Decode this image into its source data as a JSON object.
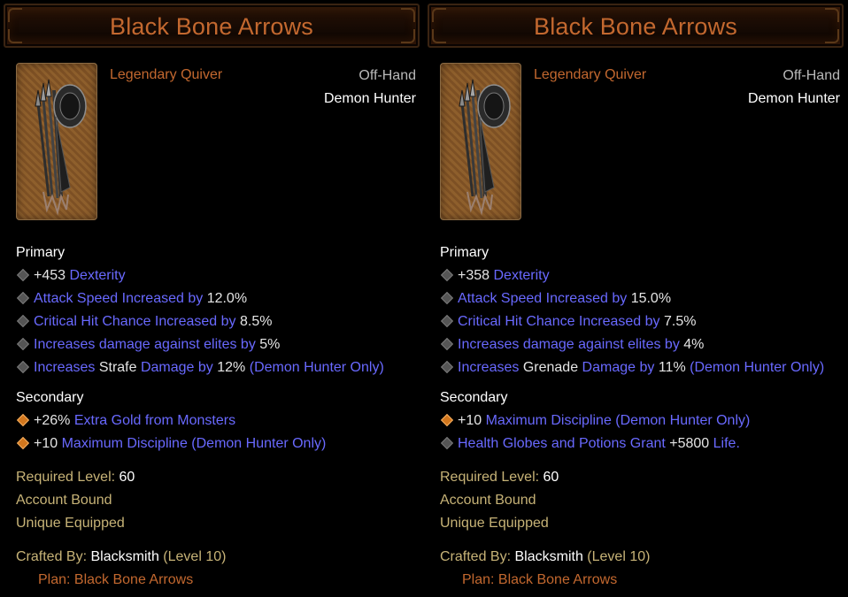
{
  "items": [
    {
      "title": "Black Bone Arrows",
      "item_type": "Legendary Quiver",
      "slot": "Off-Hand",
      "class": "Demon Hunter",
      "primary_heading": "Primary",
      "primary": [
        {
          "pre": "+453",
          "mid": "Dexterity",
          "post": "",
          "tail": ""
        },
        {
          "pre": "",
          "mid": "Attack Speed Increased by",
          "post": "12.0%",
          "tail": ""
        },
        {
          "pre": "",
          "mid": "Critical Hit Chance Increased by",
          "post": "8.5%",
          "tail": ""
        },
        {
          "pre": "",
          "mid": "Increases damage against elites by",
          "post": "5%",
          "tail": ""
        },
        {
          "pre": "",
          "mid": "Increases",
          "post": "Strafe",
          "tail": "Damage by",
          "val": "12%",
          "extra": "(Demon Hunter Only)"
        }
      ],
      "secondary_heading": "Secondary",
      "secondary": [
        {
          "pre": "+26%",
          "mid": "Extra Gold from Monsters"
        },
        {
          "pre": "+10",
          "mid": "Maximum Discipline (Demon Hunter Only)"
        }
      ],
      "required_level_label": "Required Level:",
      "required_level_value": "60",
      "account_bound": "Account Bound",
      "unique_equipped": "Unique Equipped",
      "crafted_by_label": "Crafted By:",
      "crafted_by_name": "Blacksmith",
      "crafted_by_level": "(Level 10)",
      "plan": "Plan: Black Bone Arrows"
    },
    {
      "title": "Black Bone Arrows",
      "item_type": "Legendary Quiver",
      "slot": "Off-Hand",
      "class": "Demon Hunter",
      "primary_heading": "Primary",
      "primary": [
        {
          "pre": "+358",
          "mid": "Dexterity",
          "post": "",
          "tail": ""
        },
        {
          "pre": "",
          "mid": "Attack Speed Increased by",
          "post": "15.0%",
          "tail": ""
        },
        {
          "pre": "",
          "mid": "Critical Hit Chance Increased by",
          "post": "7.5%",
          "tail": ""
        },
        {
          "pre": "",
          "mid": "Increases damage against elites by",
          "post": "4%",
          "tail": ""
        },
        {
          "pre": "",
          "mid": "Increases",
          "post": "Grenade",
          "tail": "Damage by",
          "val": "11%",
          "extra": "(Demon Hunter Only)"
        }
      ],
      "secondary_heading": "Secondary",
      "secondary": [
        {
          "pre": "+10",
          "mid": "Maximum Discipline (Demon Hunter Only)"
        },
        {
          "pre": "",
          "mid": "Health Globes and Potions Grant",
          "val": "+5800",
          "extra": "Life."
        }
      ],
      "required_level_label": "Required Level:",
      "required_level_value": "60",
      "account_bound": "Account Bound",
      "unique_equipped": "Unique Equipped",
      "crafted_by_label": "Crafted By:",
      "crafted_by_name": "Blacksmith",
      "crafted_by_level": "(Level 10)",
      "plan": "Plan: Black Bone Arrows"
    }
  ],
  "icons": [
    "quiver-icon",
    "diamond-bullet-icon"
  ],
  "colors": {
    "legendary": "#c3682f",
    "affix": "#6969ff",
    "tan": "#c7b377",
    "background": "#000000"
  }
}
